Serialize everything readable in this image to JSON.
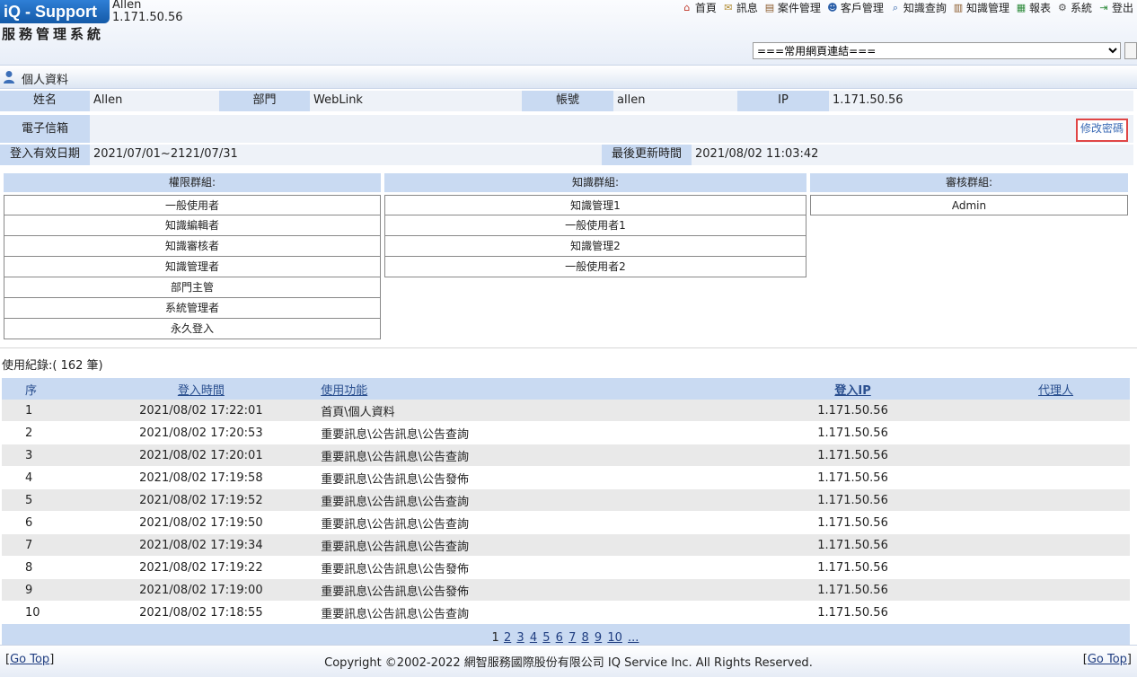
{
  "header": {
    "logo_text": "iQ - Support",
    "logo_subtitle": "服務管理系統",
    "user_name": "Allen",
    "user_ip": "1.171.50.56",
    "nav": [
      {
        "label": "首頁",
        "icon": "home-icon"
      },
      {
        "label": "訊息",
        "icon": "mail-icon"
      },
      {
        "label": "案件管理",
        "icon": "case-icon"
      },
      {
        "label": "客戶管理",
        "icon": "customer-icon"
      },
      {
        "label": "知識查詢",
        "icon": "search-icon"
      },
      {
        "label": "知識管理",
        "icon": "book-icon"
      },
      {
        "label": "報表",
        "icon": "report-icon"
      },
      {
        "label": "系統",
        "icon": "system-icon"
      },
      {
        "label": "登出",
        "icon": "logout-icon"
      }
    ],
    "quick_links_selected": "===常用網頁連結==="
  },
  "section": {
    "title": "個人資料"
  },
  "profile": {
    "name_label": "姓名",
    "name_value": "Allen",
    "dept_label": "部門",
    "dept_value": "WebLink",
    "account_label": "帳號",
    "account_value": "allen",
    "ip_label": "IP",
    "ip_value": "1.171.50.56",
    "email_label": "電子信箱",
    "email_value": "",
    "change_password": "修改密碼",
    "valid_label": "登入有效日期",
    "valid_value": "2021/07/01~2121/07/31",
    "updated_label": "最後更新時間",
    "updated_value": "2021/08/02 11:03:42"
  },
  "groups": {
    "permission": {
      "title": "權限群組:",
      "items": [
        "一般使用者",
        "知識編輯者",
        "知識審核者",
        "知識管理者",
        "部門主管",
        "系統管理者",
        "永久登入"
      ]
    },
    "knowledge": {
      "title": "知識群組:",
      "items": [
        "知識管理1",
        "一般使用者1",
        "知識管理2",
        "一般使用者2"
      ]
    },
    "review": {
      "title": "審核群組:",
      "items": [
        "Admin"
      ]
    }
  },
  "log": {
    "count_text": "使用紀錄:( 162 筆)",
    "headers": {
      "seq": "序",
      "time": "登入時間",
      "func": "使用功能",
      "ip": "登入IP",
      "agent": "代理人"
    },
    "rows": [
      {
        "seq": "1",
        "time": "2021/08/02 17:22:01",
        "func": "首頁\\個人資料",
        "ip": "1.171.50.56",
        "agent": ""
      },
      {
        "seq": "2",
        "time": "2021/08/02 17:20:53",
        "func": "重要訊息\\公告訊息\\公告查詢",
        "ip": "1.171.50.56",
        "agent": ""
      },
      {
        "seq": "3",
        "time": "2021/08/02 17:20:01",
        "func": "重要訊息\\公告訊息\\公告查詢",
        "ip": "1.171.50.56",
        "agent": ""
      },
      {
        "seq": "4",
        "time": "2021/08/02 17:19:58",
        "func": "重要訊息\\公告訊息\\公告發佈",
        "ip": "1.171.50.56",
        "agent": ""
      },
      {
        "seq": "5",
        "time": "2021/08/02 17:19:52",
        "func": "重要訊息\\公告訊息\\公告查詢",
        "ip": "1.171.50.56",
        "agent": ""
      },
      {
        "seq": "6",
        "time": "2021/08/02 17:19:50",
        "func": "重要訊息\\公告訊息\\公告查詢",
        "ip": "1.171.50.56",
        "agent": ""
      },
      {
        "seq": "7",
        "time": "2021/08/02 17:19:34",
        "func": "重要訊息\\公告訊息\\公告查詢",
        "ip": "1.171.50.56",
        "agent": ""
      },
      {
        "seq": "8",
        "time": "2021/08/02 17:19:22",
        "func": "重要訊息\\公告訊息\\公告發佈",
        "ip": "1.171.50.56",
        "agent": ""
      },
      {
        "seq": "9",
        "time": "2021/08/02 17:19:00",
        "func": "重要訊息\\公告訊息\\公告發佈",
        "ip": "1.171.50.56",
        "agent": ""
      },
      {
        "seq": "10",
        "time": "2021/08/02 17:18:55",
        "func": "重要訊息\\公告訊息\\公告查詢",
        "ip": "1.171.50.56",
        "agent": ""
      }
    ],
    "pages": [
      "1",
      "2",
      "3",
      "4",
      "5",
      "6",
      "7",
      "8",
      "9",
      "10",
      "..."
    ]
  },
  "footer": {
    "go_top": "Go Top",
    "copyright": "Copyright ©2002-2022 網智服務國際股份有限公司 IQ Service Inc. All Rights Reserved."
  },
  "colors": {
    "label_bg": "#c9daf2",
    "value_bg": "#eef2f8",
    "accent_red": "#e04646",
    "link": "#1f3d80"
  }
}
